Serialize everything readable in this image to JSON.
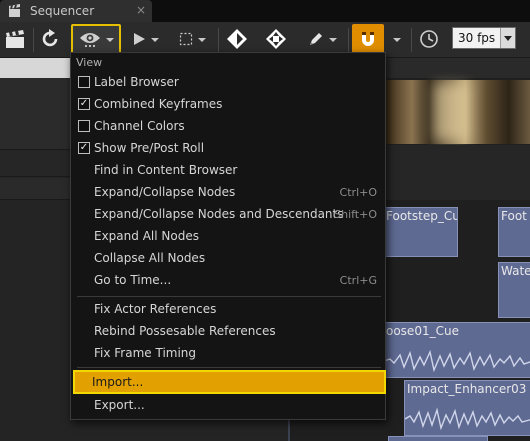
{
  "window": {
    "tab_title": "Sequencer",
    "close_glyph": "×"
  },
  "toolbar": {
    "buttons": [
      "clapperboard-icon",
      "refresh-icon",
      "eye-icon",
      "play-icon",
      "selection-icon",
      "keyframe-icon",
      "transform-icon",
      "pencil-icon",
      "magnet-icon",
      "clock-icon"
    ],
    "fps_value": "30 fps",
    "accent": "#e08d00",
    "highlight": "#e6c000"
  },
  "menu": {
    "section_label": "View",
    "items": [
      {
        "label": "Label Browser",
        "checked": false
      },
      {
        "label": "Combined Keyframes",
        "checked": true
      },
      {
        "label": "Channel Colors",
        "checked": false
      },
      {
        "label": "Show Pre/Post Roll",
        "checked": true
      },
      {
        "label": "Find in Content Browser"
      },
      {
        "label": "Expand/Collapse Nodes",
        "shortcut": "Ctrl+O"
      },
      {
        "label": "Expand/Collapse Nodes and Descendants",
        "shortcut": "Shift+O"
      },
      {
        "label": "Expand All Nodes"
      },
      {
        "label": "Collapse All Nodes"
      },
      {
        "label": "Go to Time...",
        "shortcut": "Ctrl+G"
      },
      {
        "label": "Fix Actor References"
      },
      {
        "label": "Rebind Possesable References"
      },
      {
        "label": "Fix Frame Timing"
      },
      {
        "label": "Import...",
        "highlighted": true
      },
      {
        "label": "Export..."
      }
    ],
    "highlight_color": "#e2a100"
  },
  "timeline": {
    "clips": [
      {
        "label": "Footstep_Cue"
      },
      {
        "label": "Foot"
      },
      {
        "label": "Wate"
      },
      {
        "label": "oose01_Cue"
      },
      {
        "label": "Impact_Enhancer03"
      }
    ],
    "clip_color": "#5f6a93"
  }
}
